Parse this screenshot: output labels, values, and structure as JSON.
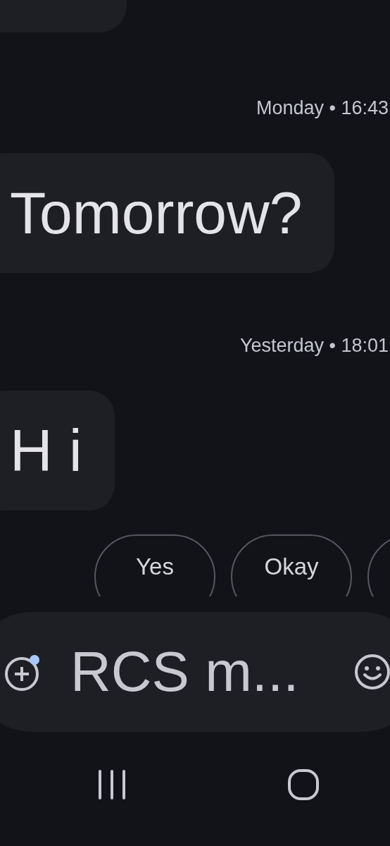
{
  "messages": [
    {
      "kind": "fragment"
    },
    {
      "kind": "timestamp",
      "text": "Monday • 16:43"
    },
    {
      "kind": "bubble",
      "text": "Tomorrow?"
    },
    {
      "kind": "timestamp",
      "text": "Yesterday • 18:01"
    },
    {
      "kind": "bubble",
      "text": "H i"
    }
  ],
  "suggestions": [
    {
      "kind": "chip",
      "label": "Yes"
    },
    {
      "kind": "chip",
      "label": "Okay"
    },
    {
      "kind": "cut"
    }
  ],
  "compose": {
    "placeholder": "RCS m...",
    "attach_badge": true
  },
  "nav": [
    {
      "kind": "recents"
    },
    {
      "kind": "home"
    }
  ]
}
